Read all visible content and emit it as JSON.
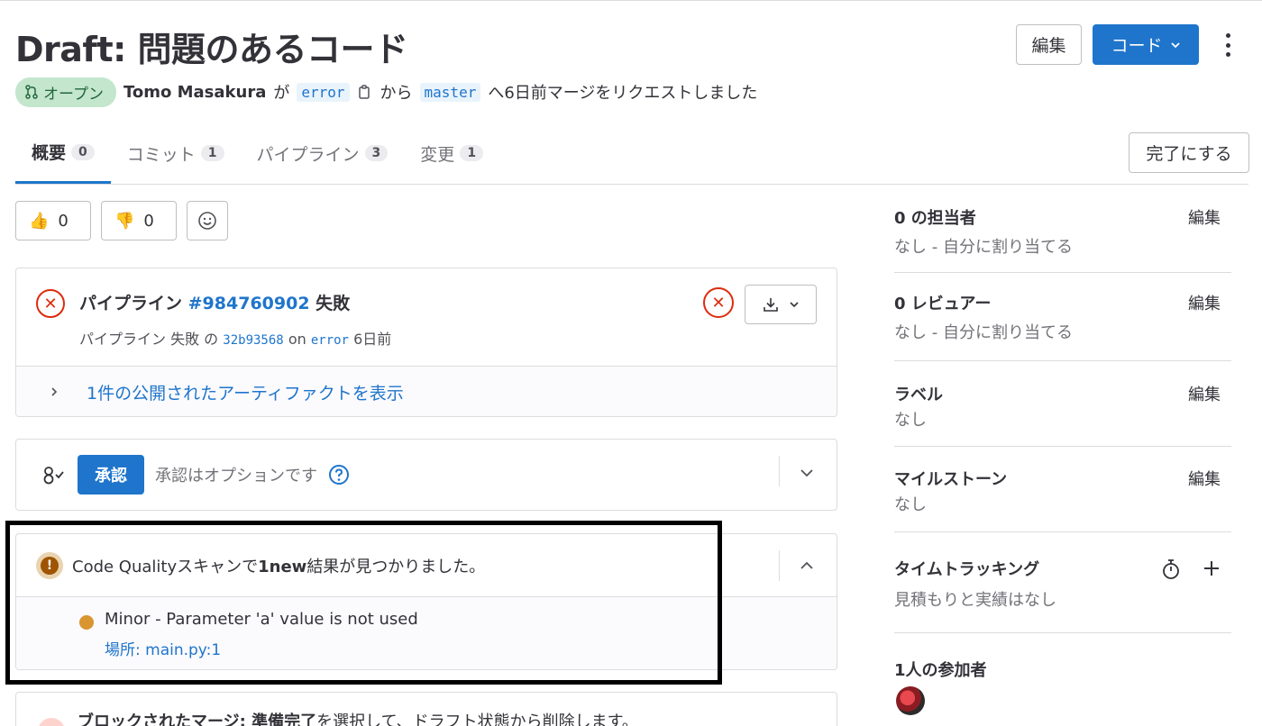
{
  "header": {
    "title": "Draft: 問題のあるコード",
    "edit_label": "編集",
    "code_label": "コード"
  },
  "meta": {
    "status": "オープン",
    "author": "Tomo Masakura",
    "ga": "が",
    "source_branch": "error",
    "kara": "から",
    "target_branch": "master",
    "suffix": "へ6日前マージをリクエストしました"
  },
  "tabs": [
    {
      "label": "概要",
      "count": "0"
    },
    {
      "label": "コミット",
      "count": "1"
    },
    {
      "label": "パイプライン",
      "count": "3"
    },
    {
      "label": "変更",
      "count": "1"
    }
  ],
  "done_label": "完了にする",
  "reactions": {
    "thumbs_up": "0",
    "thumbs_down": "0"
  },
  "pipeline": {
    "prefix": "パイプライン",
    "id": "#984760902",
    "status": "失敗",
    "sub_prefix": "パイプライン 失敗 の",
    "commit": "32b93568",
    "on": "on",
    "branch": "error",
    "time": "6日前",
    "artifacts_link": "1件の公開されたアーティファクトを表示"
  },
  "approval": {
    "button": "承認",
    "text": "承認はオプションです"
  },
  "code_quality": {
    "summary_a": "Code Qualityスキャンで",
    "summary_b": "1new",
    "summary_c": "結果が見つかりました。",
    "issue": "Minor - Parameter 'a' value is not used",
    "location": "場所: main.py:1",
    "severity_color": "#d99530"
  },
  "blocked": {
    "bold": "ブロックされたマージ: 準備完了",
    "rest": "を選択して、ドラフト状態から削除します。"
  },
  "sidebar": {
    "assignee": {
      "title": "0 の担当者",
      "sub": "なし - 自分に割り当てる",
      "edit": "編集"
    },
    "reviewer": {
      "title": "0 レビュアー",
      "sub": "なし - 自分に割り当てる",
      "edit": "編集"
    },
    "labels": {
      "title": "ラベル",
      "sub": "なし",
      "edit": "編集"
    },
    "milestone": {
      "title": "マイルストーン",
      "sub": "なし",
      "edit": "編集"
    },
    "time_tracking": {
      "title": "タイムトラッキング",
      "sub": "見積もりと実績はなし"
    },
    "participants": {
      "title": "1人の参加者"
    }
  }
}
